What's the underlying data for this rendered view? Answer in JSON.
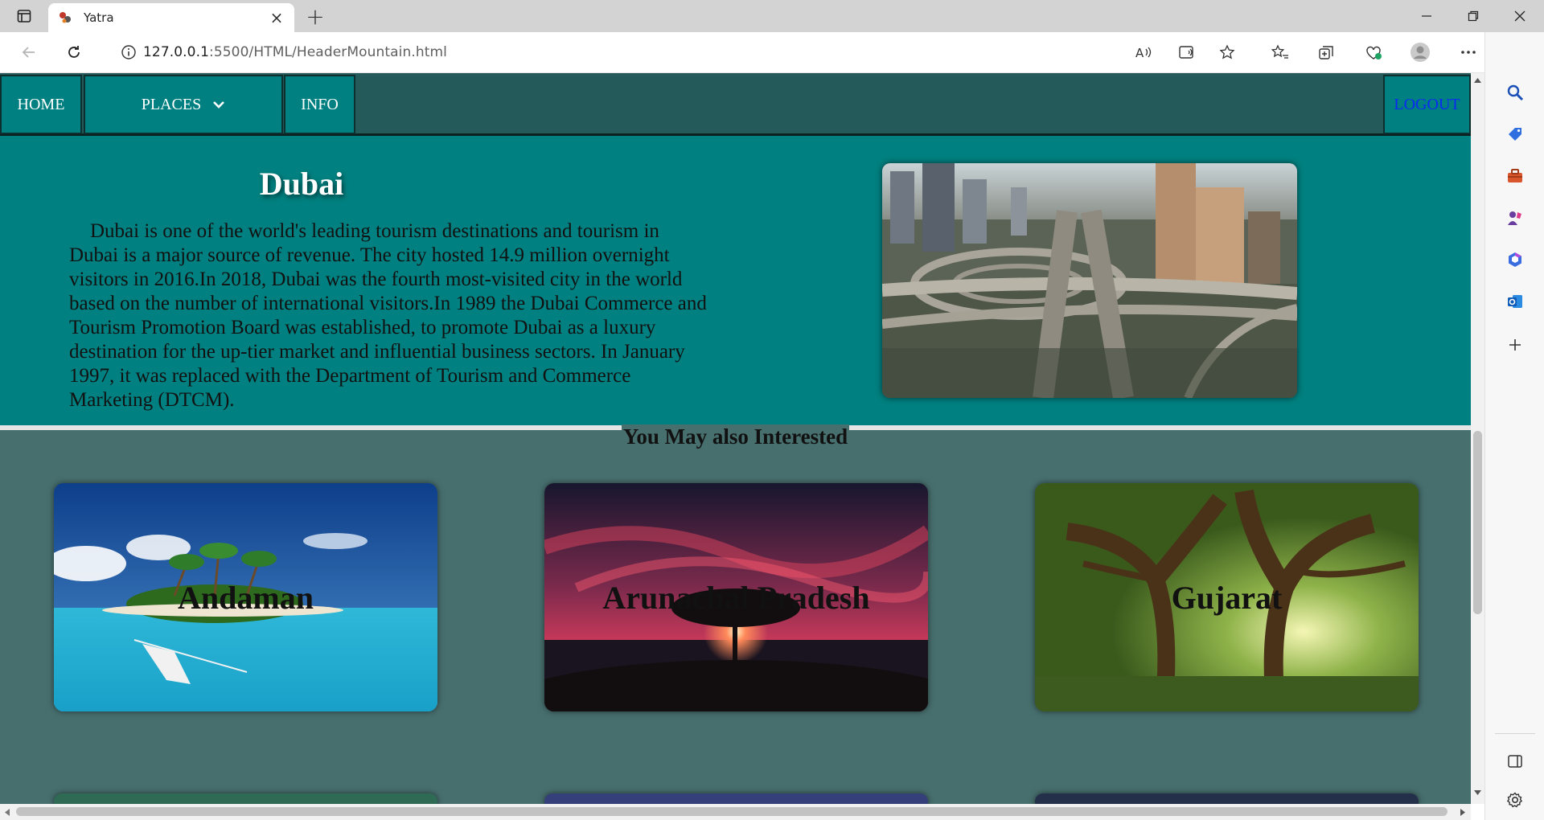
{
  "browser": {
    "tab_title": "Yatra",
    "url_host": "127.0.0.1",
    "url_path": ":5500/HTML/HeaderMountain.html"
  },
  "nav": {
    "home": "HOME",
    "places": "PLACES",
    "info": "INFO",
    "logout": "LOGOUT"
  },
  "main": {
    "title": "Dubai",
    "description": "Dubai is one of the world's leading tourism destinations and tourism in Dubai is a major source of revenue. The city hosted 14.9 million overnight visitors in 2016.In 2018, Dubai was the fourth most-visited city in the world based on the number of international visitors.In 1989 the Dubai Commerce and Tourism Promotion Board was established, to promote Dubai as a luxury destination for the up-tier market and influential business sectors. In January 1997, it was replaced with the Department of Tourism and Commerce Marketing (DTCM)."
  },
  "suggestions": {
    "heading": "You May also Interested",
    "cards": [
      {
        "label": "Andaman"
      },
      {
        "label": "Arunachal Pradesh"
      },
      {
        "label": "Gujarat"
      }
    ]
  },
  "colors": {
    "teal": "#008080",
    "nav_bg": "#255a5a",
    "suggest_bg": "#476f6e",
    "logout_link": "#0a2bf2"
  },
  "icons": [
    "tab-actions-icon",
    "favicon-icon",
    "close-icon",
    "plus-icon",
    "minimize-icon",
    "restore-icon",
    "window-close-icon",
    "back-icon",
    "refresh-icon",
    "info-icon",
    "read-aloud-icon",
    "immersive-reader-icon",
    "favorite-star-icon",
    "favorites-icon",
    "collections-icon",
    "browser-essentials-icon",
    "profile-icon",
    "more-icon",
    "copilot-icon",
    "search-icon",
    "shopping-icon",
    "tools-icon",
    "games-icon",
    "office-icon",
    "outlook-icon",
    "add-icon",
    "sidebar-toggle-icon",
    "settings-icon",
    "chevron-down-icon"
  ]
}
